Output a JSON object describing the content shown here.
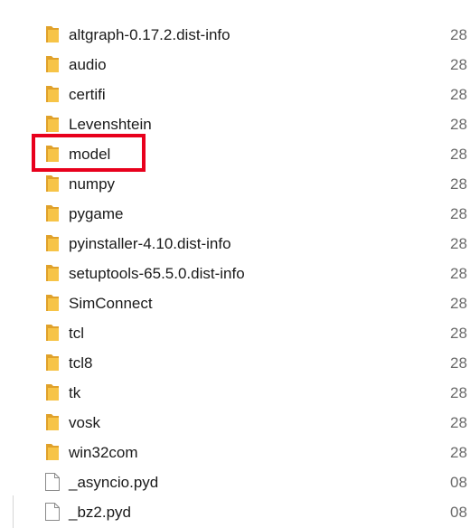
{
  "files": [
    {
      "name": "altgraph-0.17.2.dist-info",
      "date": "28",
      "type": "folder"
    },
    {
      "name": "audio",
      "date": "28",
      "type": "folder"
    },
    {
      "name": "certifi",
      "date": "28",
      "type": "folder"
    },
    {
      "name": "Levenshtein",
      "date": "28",
      "type": "folder"
    },
    {
      "name": "model",
      "date": "28",
      "type": "folder"
    },
    {
      "name": "numpy",
      "date": "28",
      "type": "folder"
    },
    {
      "name": "pygame",
      "date": "28",
      "type": "folder"
    },
    {
      "name": "pyinstaller-4.10.dist-info",
      "date": "28",
      "type": "folder"
    },
    {
      "name": "setuptools-65.5.0.dist-info",
      "date": "28",
      "type": "folder"
    },
    {
      "name": "SimConnect",
      "date": "28",
      "type": "folder"
    },
    {
      "name": "tcl",
      "date": "28",
      "type": "folder"
    },
    {
      "name": "tcl8",
      "date": "28",
      "type": "folder"
    },
    {
      "name": "tk",
      "date": "28",
      "type": "folder"
    },
    {
      "name": "vosk",
      "date": "28",
      "type": "folder"
    },
    {
      "name": "win32com",
      "date": "28",
      "type": "folder"
    },
    {
      "name": "_asyncio.pyd",
      "date": "08",
      "type": "file"
    },
    {
      "name": "_bz2.pyd",
      "date": "08",
      "type": "file"
    }
  ],
  "highlighted_item": "model",
  "colors": {
    "highlight_border": "#e8001c",
    "folder_body": "#f7c447",
    "folder_tab": "#e0a12a",
    "file_outline": "#8a8a8a"
  },
  "icons": {
    "folder": "folder-icon",
    "file": "file-icon"
  }
}
